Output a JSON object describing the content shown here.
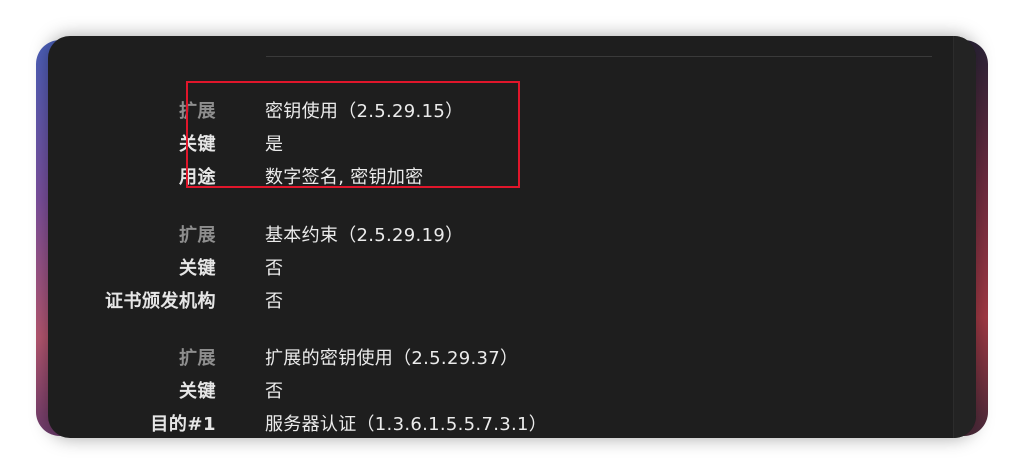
{
  "colors": {
    "window_bg": "#1e1e1e",
    "label_text": "#e6e6e6",
    "label_dim": "#8e8e8e",
    "value_text": "#ebebeb",
    "highlight_border": "#e0162b"
  },
  "sections": [
    {
      "rows": [
        {
          "label": "扩展",
          "value": "密钥使用（2.5.29.15）"
        },
        {
          "label": "关键",
          "value": "是"
        },
        {
          "label": "用途",
          "value": "数字签名, 密钥加密"
        }
      ]
    },
    {
      "rows": [
        {
          "label": "扩展",
          "value": "基本约束（2.5.29.19）"
        },
        {
          "label": "关键",
          "value": "否"
        },
        {
          "label": "证书颁发机构",
          "value": "否"
        }
      ]
    },
    {
      "rows": [
        {
          "label": "扩展",
          "value": "扩展的密钥使用（2.5.29.37）"
        },
        {
          "label": "关键",
          "value": "否"
        },
        {
          "label": "目的#1",
          "value": "服务器认证（1.3.6.1.5.5.7.3.1）"
        }
      ]
    }
  ]
}
